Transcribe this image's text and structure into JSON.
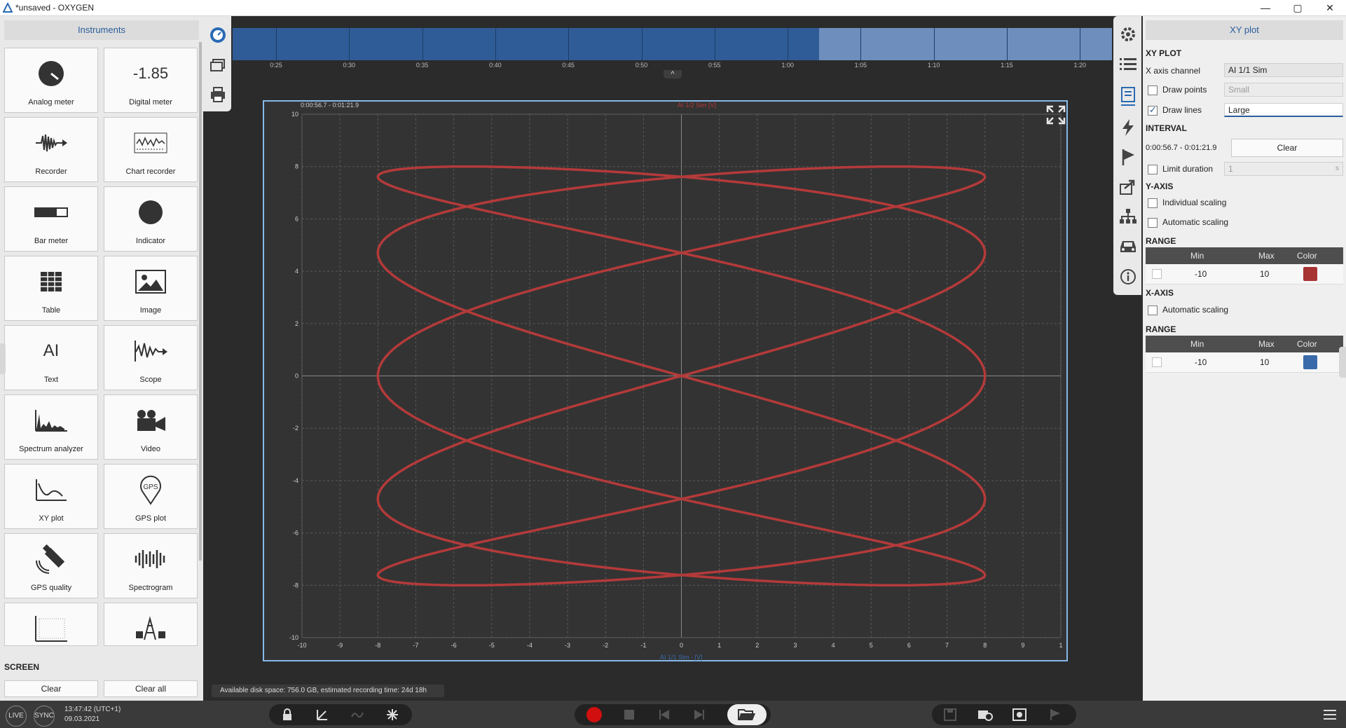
{
  "window": {
    "title": "*unsaved - OXYGEN",
    "controls": [
      "—",
      "▢",
      "✕"
    ]
  },
  "left_panel": {
    "header": "Instruments",
    "instruments": [
      {
        "label": "Analog meter",
        "icon": "analog-meter-icon"
      },
      {
        "label": "Digital meter",
        "icon": "digital-meter-icon",
        "display": "-1.85"
      },
      {
        "label": "Recorder",
        "icon": "recorder-icon"
      },
      {
        "label": "Chart recorder",
        "icon": "chart-recorder-icon"
      },
      {
        "label": "Bar meter",
        "icon": "bar-meter-icon"
      },
      {
        "label": "Indicator",
        "icon": "indicator-icon"
      },
      {
        "label": "Table",
        "icon": "table-icon"
      },
      {
        "label": "Image",
        "icon": "image-icon"
      },
      {
        "label": "Text",
        "icon": "text-icon",
        "display": "AI"
      },
      {
        "label": "Scope",
        "icon": "scope-icon"
      },
      {
        "label": "Spectrum analyzer",
        "icon": "spectrum-analyzer-icon"
      },
      {
        "label": "Video",
        "icon": "video-icon"
      },
      {
        "label": "XY plot",
        "icon": "xy-plot-icon"
      },
      {
        "label": "GPS plot",
        "icon": "gps-plot-icon",
        "display": "GPS"
      },
      {
        "label": "GPS quality",
        "icon": "gps-quality-icon"
      },
      {
        "label": "Spectrogram",
        "icon": "spectrogram-icon"
      },
      {
        "label": "",
        "icon": "heatmap-icon"
      },
      {
        "label": "",
        "icon": "power-icon"
      }
    ],
    "screen_section": "SCREEN",
    "clear_label": "Clear",
    "clear_all_label": "Clear all"
  },
  "timeline": {
    "tick_labels": [
      "0:25",
      "0:30",
      "0:35",
      "0:40",
      "0:45",
      "0:50",
      "0:55",
      "1:00",
      "1:05",
      "1:10",
      "1:15",
      "1:20"
    ]
  },
  "plot": {
    "interval_label": "0:00:56.7 - 0:01:21.9",
    "y_channel_label": "AI 1/2 Sim [V]",
    "x_channel_label": "AI 1/1 Sim - [V]",
    "x_ticks": [
      "-10",
      "-9",
      "-8",
      "-7",
      "-6",
      "-5",
      "-4",
      "-3",
      "-2",
      "-1",
      "0",
      "1",
      "2",
      "3",
      "4",
      "5",
      "6",
      "7",
      "8",
      "9",
      "1"
    ],
    "y_ticks": [
      "10",
      "8",
      "6",
      "4",
      "2",
      "0",
      "-2",
      "-4",
      "-6",
      "-8",
      "-10"
    ],
    "line_color": "#b43a3a"
  },
  "chart_data": {
    "type": "line",
    "title": "",
    "xlabel": "AI 1/1 Sim - [V]",
    "ylabel": "AI 1/2 Sim [V]",
    "xlim": [
      -10,
      10
    ],
    "ylim": [
      -10,
      10
    ],
    "grid": true,
    "series": [
      {
        "name": "AI 1/2 Sim",
        "curve": "lissajous",
        "x_amplitude": 8,
        "y_amplitude": 8,
        "frequency_ratio_x_to_y": [
          5,
          2
        ],
        "x": [
          0,
          4.7,
          7.61,
          7.61,
          4.7,
          0,
          -4.7,
          -7.61,
          -7.61,
          -4.7,
          0
        ],
        "y": [
          0,
          7.61,
          4.7,
          -4.7,
          -7.61,
          0,
          7.61,
          4.7,
          -4.7,
          -7.61,
          0
        ]
      }
    ]
  },
  "right_panel": {
    "header": "XY plot",
    "xy_plot_section": "XY PLOT",
    "x_axis_channel_label": "X axis channel",
    "x_axis_channel_value": "AI 1/1 Sim",
    "draw_points_label": "Draw points",
    "draw_points_checked": false,
    "draw_points_size": "Small",
    "draw_lines_label": "Draw lines",
    "draw_lines_checked": true,
    "draw_lines_size": "Large",
    "interval_section": "INTERVAL",
    "interval_value": "0:00:56.7 - 0:01:21.9",
    "interval_clear": "Clear",
    "limit_duration_label": "Limit duration",
    "limit_duration_value": "1",
    "limit_duration_unit": "s",
    "y_axis_section": "Y-AXIS",
    "individual_scaling_label": "Individual scaling",
    "automatic_scaling_label": "Automatic scaling",
    "range_section": "RANGE",
    "range_headers": {
      "min": "Min",
      "max": "Max",
      "color": "Color"
    },
    "y_range": {
      "min": "-10",
      "max": "10",
      "color": "#a83333"
    },
    "x_axis_section": "X-AXIS",
    "x_automatic_scaling_label": "Automatic scaling",
    "x_range": {
      "min": "-10",
      "max": "10",
      "color": "#3a6aaa"
    }
  },
  "status": {
    "disk_space": "Available disk space: 756.0 GB, estimated recording time: 24d 18h"
  },
  "bottom_bar": {
    "live_label": "LIVE",
    "sync_label": "SYNC",
    "time": "13:47:42 (UTC+1)",
    "date": "09.03.2021"
  }
}
